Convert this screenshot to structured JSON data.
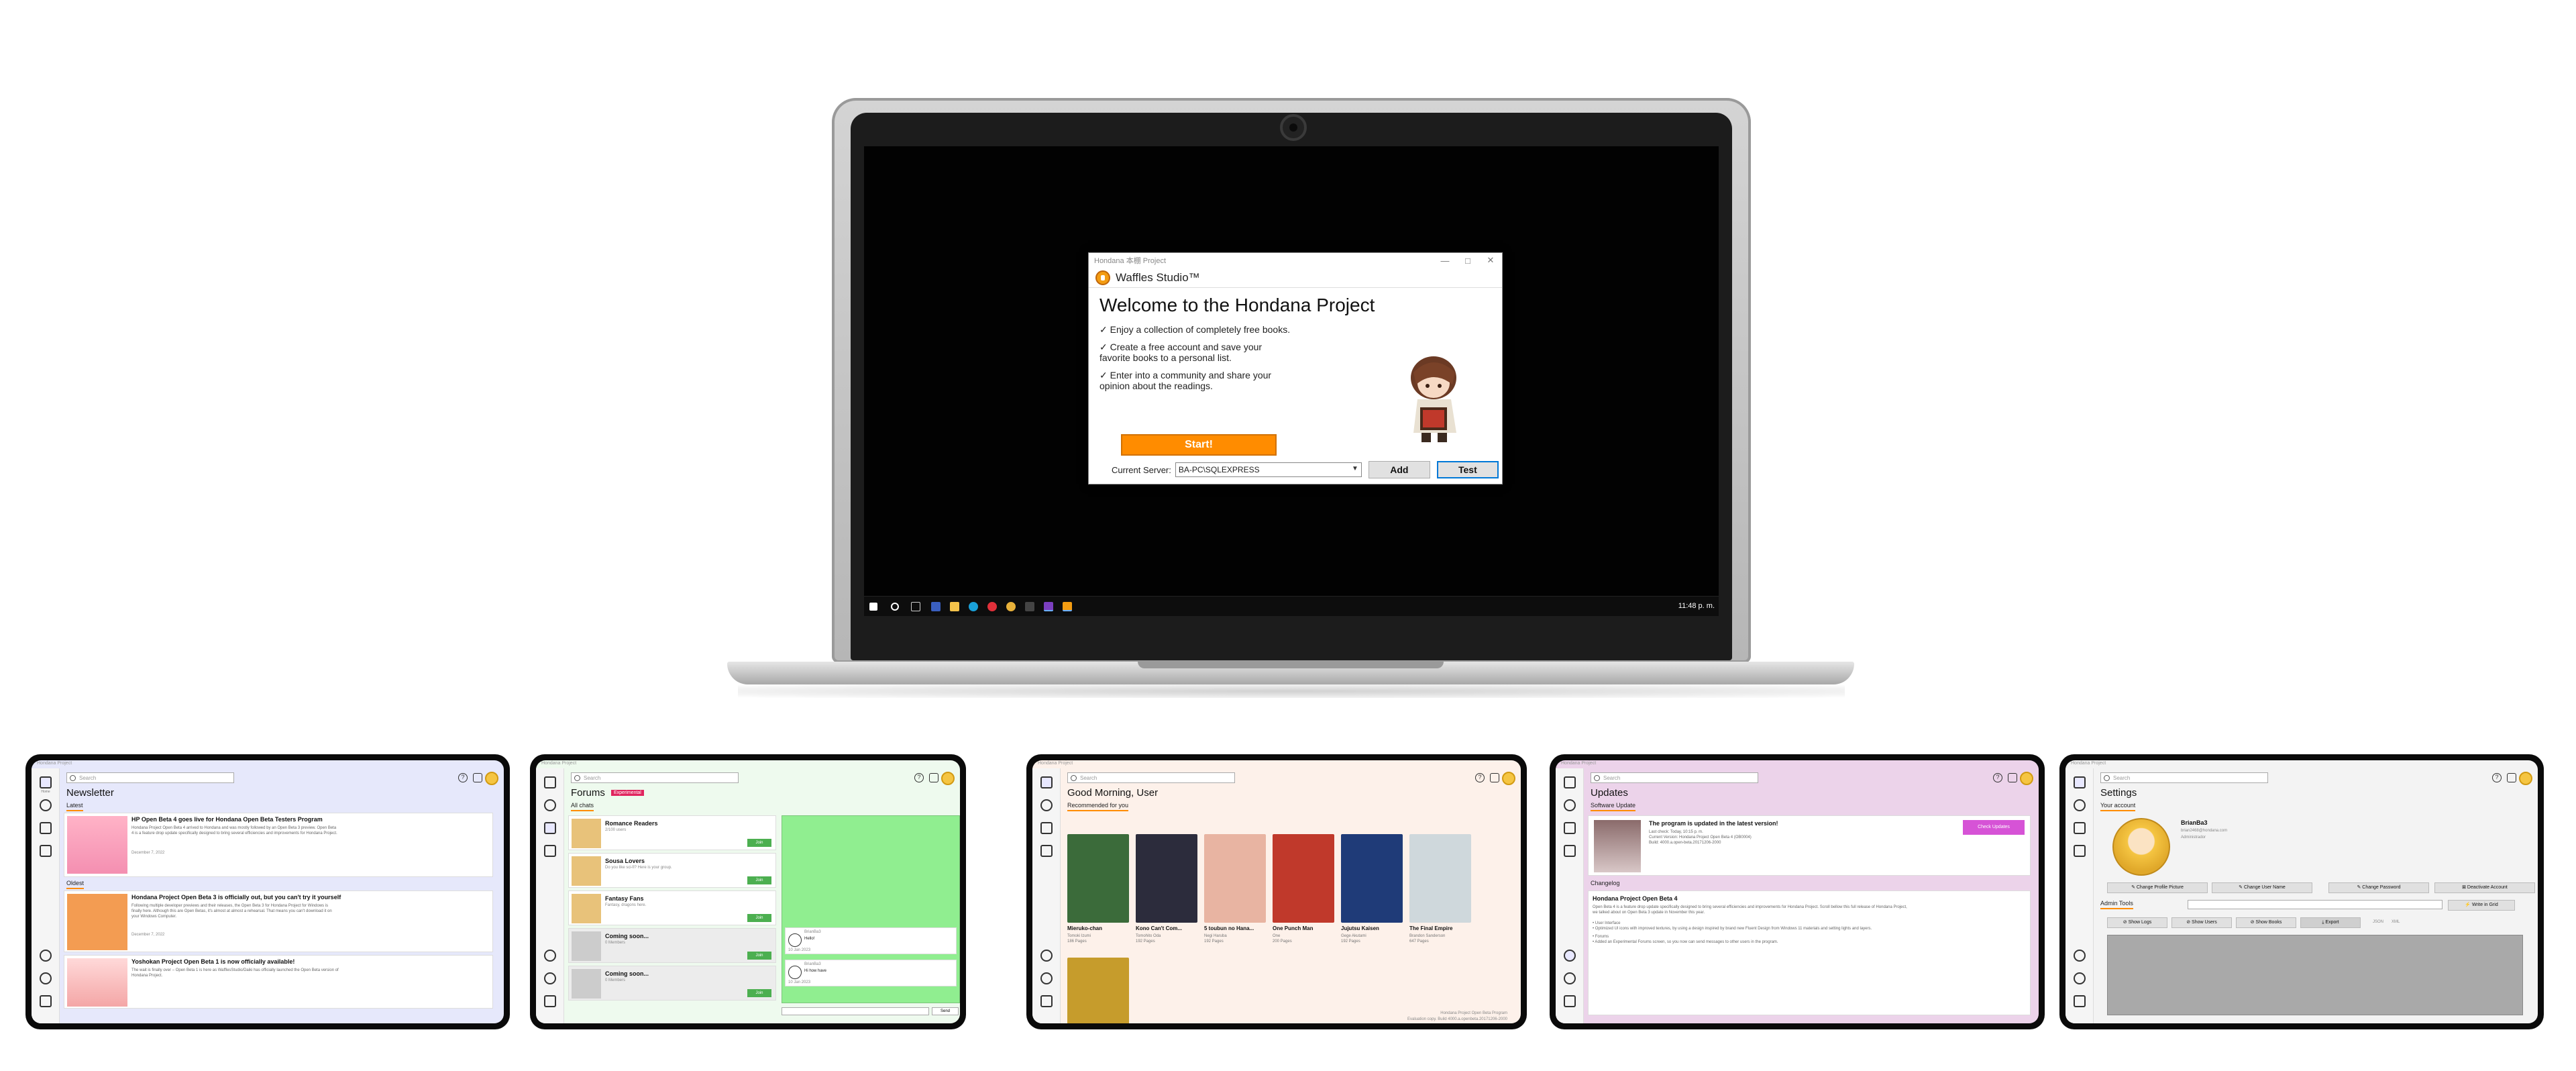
{
  "colors": {
    "accent_orange": "#ff8c00",
    "newsletter_bg": "#e6e8fb",
    "forums_bg": "#eefaee",
    "home_bg": "#fdf1ea",
    "updates_bg": "#ecd3ea",
    "settings_bg": "#f3f3f3",
    "join_green": "#4caf50",
    "chat_green": "#90ee90",
    "experimental_red": "#e0245e",
    "check_updates_purple": "#d653d6"
  },
  "dialog": {
    "window_title": "Hondana 本棚 Project",
    "brand": "Waffles Studio™",
    "heading": "Welcome to the Hondana Project",
    "features": [
      "✓  Enjoy a collection of completely free books.",
      "✓  Create a free account and save your favorite books to a personal list.",
      "✓  Enter into a community and share your opinion about the readings."
    ],
    "start_label": "Start!",
    "server_label": "Current Server:",
    "server_value": "BA-PC\\SQLEXPRESS",
    "add_label": "Add",
    "test_label": "Test",
    "win_minimize": "—",
    "win_maximize": "□",
    "win_close": "✕"
  },
  "taskbar": {
    "clock": "11:48 p. m."
  },
  "app": {
    "title": "Hondana Project",
    "search_placeholder": "Search",
    "help": "?",
    "nav": [
      "Home",
      "Forums",
      "News",
      "Updates",
      "Logout"
    ]
  },
  "newsletter": {
    "title": "Newsletter",
    "tab_latest": "Latest",
    "tab_oldest": "Oldest",
    "posts": [
      {
        "title": "HP Open Beta 4 goes live for Hondana Open Beta Testers Program",
        "text": "Hondana Project Open Beta 4 arrived to Hondana and was mostly followed by an Open Beta 3 preview. Open Beta 4 is a feature drop update specifically designed to bring several efficiencies and improvements for Hondana Project.",
        "date": "December 7, 2022"
      },
      {
        "title": "Hondana Project Open Beta 3 is officially out, but you can't try it yourself",
        "text": "Following multiple developer previews and their releases, the Open Beta 3 for Hondana Project for Windows is finally here. Although this are Open Betas, it's almost at almost a rehearsal. That means you can't download it on your Windows Computer.",
        "date": "December 7, 2022"
      },
      {
        "title": "Yoshokan Project Open Beta 1 is now officially available!",
        "text": "The wait is finally over – Open Beta 1 is here as WafflesStudio/Daiki has officially launched the Open Beta version of Hondana Project.",
        "date": ""
      }
    ]
  },
  "forums": {
    "title": "Forums",
    "badge": "Experimental",
    "tab": "All chats",
    "chats": [
      {
        "name": "Romance Readers",
        "desc": "2/100 users",
        "join": "Join"
      },
      {
        "name": "Sousa Lovers",
        "desc": "Do you like sci-fi? Here is your group.",
        "join": "Join"
      },
      {
        "name": "Fantasy Fans",
        "desc": "Fantasy, dragons here.",
        "join": "Join"
      },
      {
        "name": "Coming soon...",
        "desc": "0 Members",
        "join": "Join"
      },
      {
        "name": "Coming soon...",
        "desc": "0 Members",
        "join": "Join"
      }
    ],
    "messages": [
      {
        "user": "BrianBa3",
        "text": "Hello!",
        "date": "10 Jan 2023"
      },
      {
        "user": "BrianBa3",
        "text": "Hi how have",
        "date": "10 Jan 2023"
      }
    ],
    "send": "Send"
  },
  "home": {
    "greeting": "Good Morning, User",
    "tab": "Recommended for you",
    "books": [
      {
        "title": "Mieruko-chan",
        "author": "Tomoki Izumi",
        "pages": "186 Pages",
        "color": "#3b6b3a"
      },
      {
        "title": "Kono Can't Com...",
        "author": "Tomohito Oda",
        "pages": "192 Pages",
        "color": "#2c2c3c"
      },
      {
        "title": "5 toubun no Hana...",
        "author": "Negi Haruba",
        "pages": "192 Pages",
        "color": "#e8b4a2"
      },
      {
        "title": "One Punch Man",
        "author": "One",
        "pages": "200 Pages",
        "color": "#c0392b"
      },
      {
        "title": "Jujutsu Kaisen",
        "author": "Gege Akutami",
        "pages": "192 Pages",
        "color": "#1f3b78"
      },
      {
        "title": "The Final Empire",
        "author": "Brandon Sanderson",
        "pages": "647 Pages",
        "color": "#cfd8dc"
      },
      {
        "title": "",
        "author": "",
        "pages": "",
        "color": "#c69c2c"
      }
    ],
    "footer_1": "Hondana Project Open Beta Program",
    "footer_2": "Evaluation copy. Build 4000.a.openbeta.20171206-2000"
  },
  "updates": {
    "title": "Updates",
    "tab": "Software Update",
    "status_title": "The program is updated in the latest version!",
    "status_lines": [
      "Last check: Today, 10:15 p. m.",
      "Current Version: Hondana Project Open Beta 4 (OB0004)",
      "Build: 4000.a.open-beta.20171206-2000"
    ],
    "check_button": "Check Updates",
    "changelog_label": "Changelog",
    "changelog_title": "Hondana Project Open Beta 4",
    "changelog_text": "Open Beta 4 is a feature drop update specifically designed to bring several efficiencies and improvements for Hondana Project. Scroll bellow this full release of Hondana Project, we talked about on Open Beta 3 update in November this year.",
    "changelog_items": [
      "• User Interface",
      "• Optimized UI icons with improved textures, by using a design inspired by brand new Fluent Design from Windows 11 materials and setting lights and layers.",
      "• Forums",
      "• Added an Experimental Forums screen, so you now can send messages to other users in the program."
    ]
  },
  "settings": {
    "title": "Settings",
    "tab": "Your account",
    "username": "BrianBa3",
    "email": "brian2468@hondana.com",
    "role": "Administrador",
    "buttons": [
      "✎ Change Profile Picture",
      "✎ Change User Name",
      "✎ Change Password",
      "⊠ Deactivate Account"
    ],
    "admin_label": "Admin Tools",
    "write_sql": "⚡ Write in Grid",
    "admin_buttons": [
      "⊘ Show Logs",
      "⊘ Show Users",
      "⊘ Show Books",
      "⤓ Export"
    ],
    "json": "JSON",
    "xml": "XML"
  }
}
